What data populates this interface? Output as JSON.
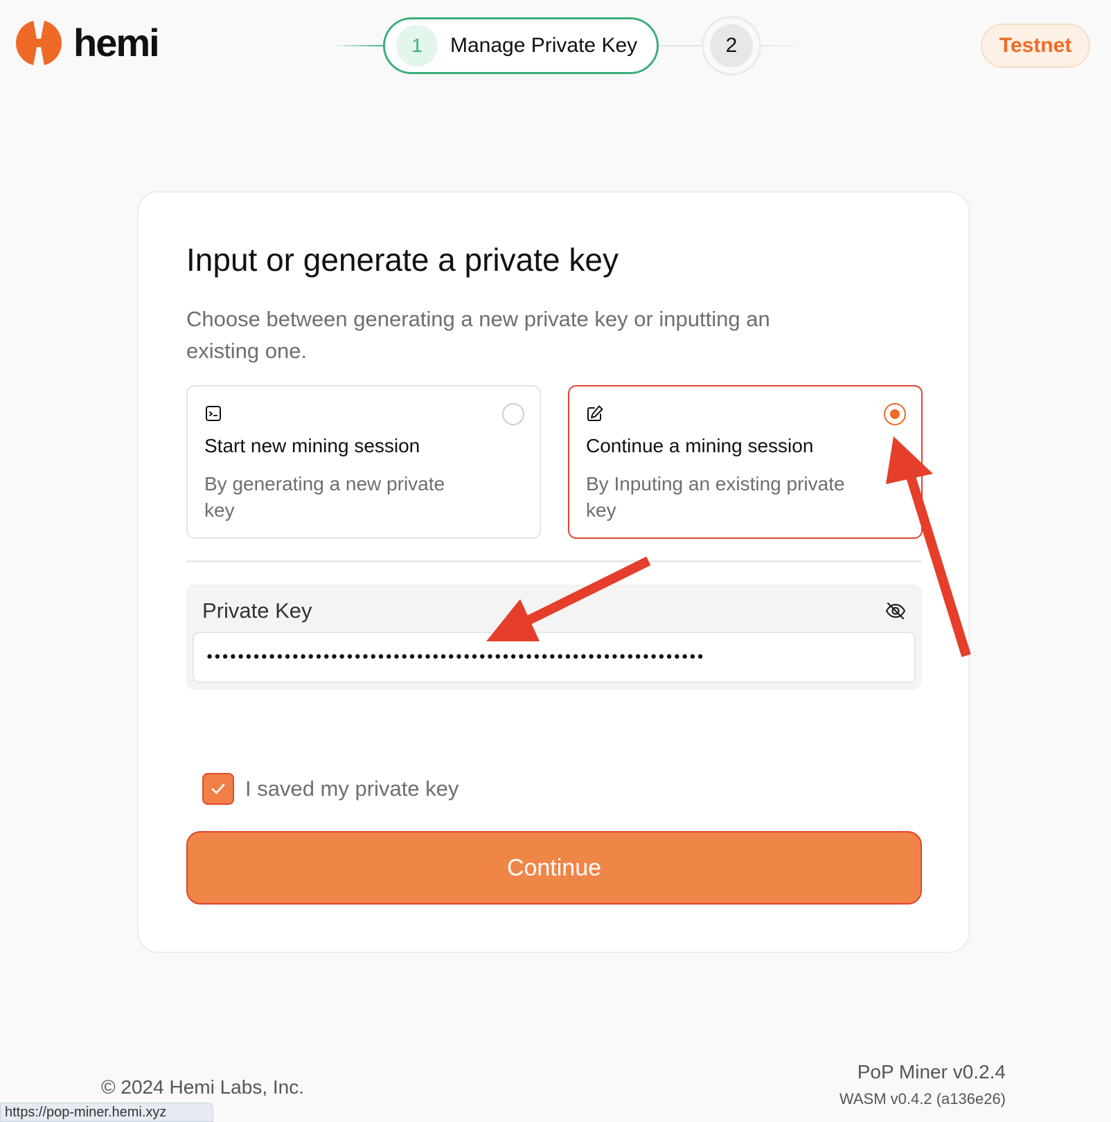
{
  "header": {
    "brand": "hemi",
    "steps": [
      {
        "number": "1",
        "label": "Manage Private Key",
        "state": "active"
      },
      {
        "number": "2",
        "label": "",
        "state": "pending"
      }
    ],
    "network_badge": "Testnet"
  },
  "card": {
    "title": "Input or generate a private key",
    "subtitle": "Choose between generating a new private key or inputting an existing one.",
    "options": [
      {
        "icon": "terminal-icon",
        "title": "Start new mining session",
        "description": "By generating a new private key",
        "selected": false
      },
      {
        "icon": "edit-icon",
        "title": "Continue a mining session",
        "description": "By Inputing an existing private key",
        "selected": true
      }
    ],
    "private_key": {
      "label": "Private Key",
      "value": "••••••••••••••••••••••••••••••••••••••••••••••••••••••••••••••••",
      "visibility_icon": "eye-off-icon"
    },
    "saved_checkbox": {
      "label": "I saved my private key",
      "checked": true
    },
    "continue_label": "Continue"
  },
  "footer": {
    "copyright": "© 2024 Hemi Labs, Inc.",
    "version": "PoP Miner v0.2.4",
    "wasm_version": "WASM v0.4.2 (a136e26)"
  },
  "status_bar_url": "https://pop-miner.hemi.xyz",
  "colors": {
    "brand_orange": "#ef6a26",
    "step_green": "#3aae7a",
    "annotation_red": "#e53e2b"
  }
}
